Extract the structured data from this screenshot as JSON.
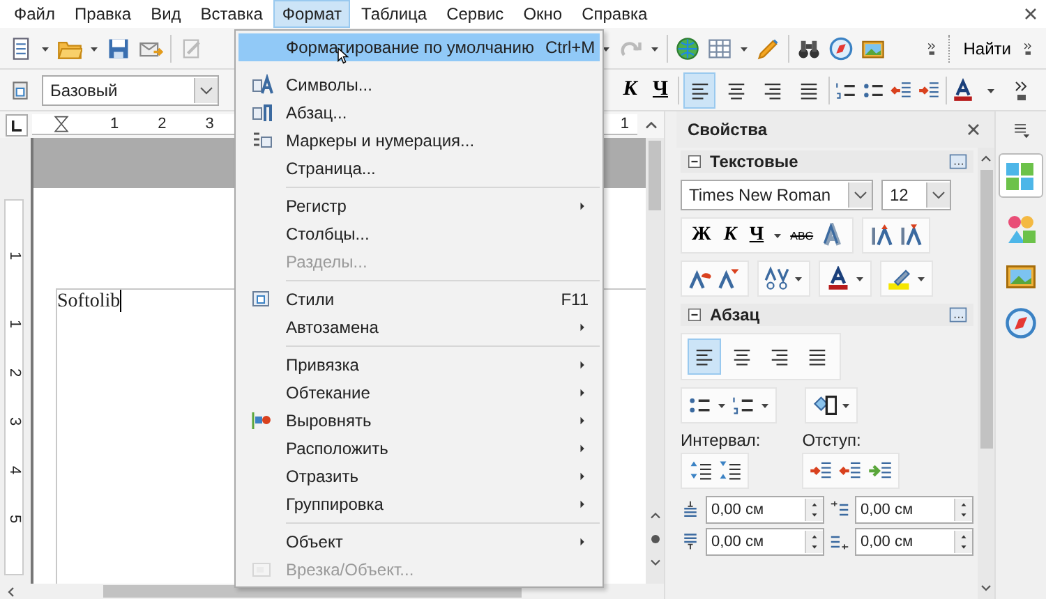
{
  "menubar": [
    {
      "label": "Файл",
      "selected": false
    },
    {
      "label": "Правка",
      "selected": false
    },
    {
      "label": "Вид",
      "selected": false
    },
    {
      "label": "Вставка",
      "selected": false
    },
    {
      "label": "Формат",
      "selected": true
    },
    {
      "label": "Таблица",
      "selected": false
    },
    {
      "label": "Сервис",
      "selected": false
    },
    {
      "label": "Окно",
      "selected": false
    },
    {
      "label": "Справка",
      "selected": false
    }
  ],
  "toolbar": {
    "find_button": "Найти"
  },
  "formatting_bar": {
    "paragraph_style": "Базовый",
    "italic": "К",
    "underline": "Ч",
    "align_buttons": [
      {
        "selected": true
      },
      {
        "selected": false
      },
      {
        "selected": false
      },
      {
        "selected": false
      }
    ]
  },
  "ruler": {
    "horizontal": [
      "1",
      "2",
      "3",
      "1"
    ],
    "vertical": [
      "1",
      "1",
      "2",
      "3",
      "4",
      "5"
    ]
  },
  "document": {
    "text": "Softolib"
  },
  "format_menu": {
    "items": [
      {
        "kind": "item",
        "label": "Форматирование по умолчанию",
        "shortcut": "Ctrl+M",
        "selected": true,
        "disabled": false,
        "submenu": false
      },
      {
        "kind": "item",
        "label": "Символы...",
        "selected": false,
        "disabled": false,
        "submenu": false
      },
      {
        "kind": "item",
        "label": "Абзац...",
        "selected": false,
        "disabled": false,
        "submenu": false
      },
      {
        "kind": "item",
        "label": "Маркеры и нумерация...",
        "selected": false,
        "disabled": false,
        "submenu": false
      },
      {
        "kind": "item",
        "label": "Страница...",
        "selected": false,
        "disabled": false,
        "submenu": false
      },
      {
        "kind": "separator"
      },
      {
        "kind": "item",
        "label": "Регистр",
        "selected": false,
        "disabled": false,
        "submenu": true
      },
      {
        "kind": "item",
        "label": "Столбцы...",
        "selected": false,
        "disabled": false,
        "submenu": false
      },
      {
        "kind": "item",
        "label": "Разделы...",
        "selected": false,
        "disabled": true,
        "submenu": false
      },
      {
        "kind": "separator"
      },
      {
        "kind": "item",
        "label": "Стили",
        "shortcut": "F11",
        "selected": false,
        "disabled": false,
        "submenu": false
      },
      {
        "kind": "item",
        "label": "Автозамена",
        "selected": false,
        "disabled": false,
        "submenu": true
      },
      {
        "kind": "separator"
      },
      {
        "kind": "item",
        "label": "Привязка",
        "selected": false,
        "disabled": false,
        "submenu": true
      },
      {
        "kind": "item",
        "label": "Обтекание",
        "selected": false,
        "disabled": false,
        "submenu": true
      },
      {
        "kind": "item",
        "label": "Выровнять",
        "selected": false,
        "disabled": false,
        "submenu": true
      },
      {
        "kind": "item",
        "label": "Расположить",
        "selected": false,
        "disabled": false,
        "submenu": true
      },
      {
        "kind": "item",
        "label": "Отразить",
        "selected": false,
        "disabled": false,
        "submenu": true
      },
      {
        "kind": "item",
        "label": "Группировка",
        "selected": false,
        "disabled": false,
        "submenu": true
      },
      {
        "kind": "separator"
      },
      {
        "kind": "item",
        "label": "Объект",
        "selected": false,
        "disabled": false,
        "submenu": true
      },
      {
        "kind": "item",
        "label": "Врезка/Объект...",
        "selected": false,
        "disabled": true,
        "submenu": false
      }
    ]
  },
  "sidebar": {
    "title": "Свойства",
    "text_section": {
      "title": "Текстовые",
      "expanded": true,
      "font": "Times New Roman",
      "size": "12",
      "bold": "Ж",
      "italic": "К",
      "underline": "Ч",
      "strikethrough": "ABC"
    },
    "paragraph_section": {
      "title": "Абзац",
      "expanded": true,
      "align_buttons": [
        {
          "selected": true
        },
        {
          "selected": false
        },
        {
          "selected": false
        },
        {
          "selected": false
        }
      ],
      "spacing_label": "Интервал:",
      "indent_label": "Отступ:",
      "fields": [
        "0,00 см",
        "0,00 см",
        "0,00 см",
        "0,00 см"
      ]
    }
  }
}
